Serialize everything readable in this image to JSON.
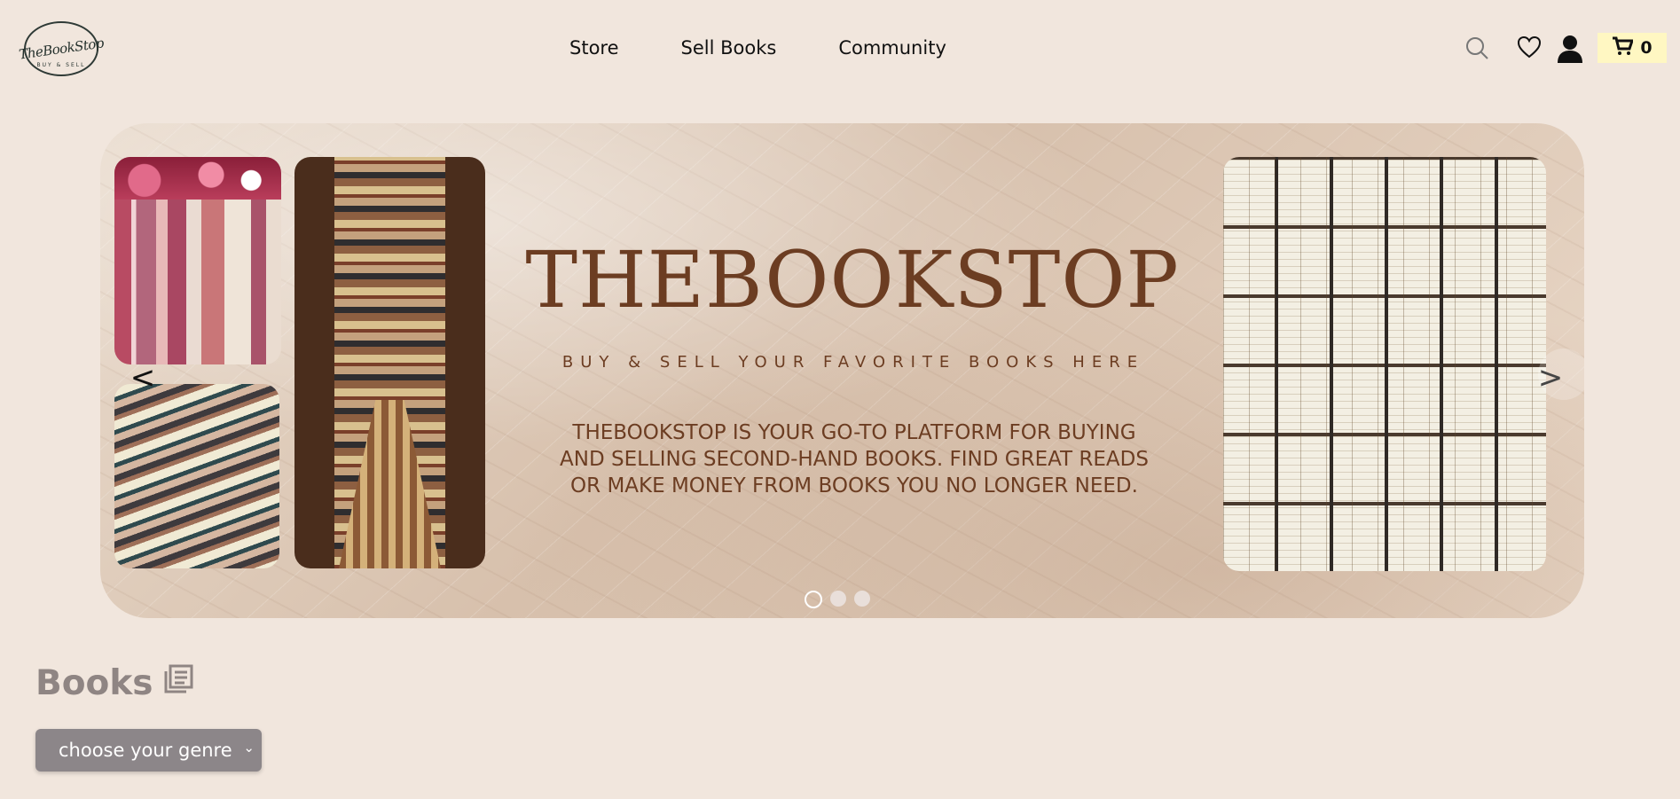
{
  "brand": {
    "logo_text": "TheBookStop",
    "logo_small": "BUY & SELL"
  },
  "nav": {
    "items": [
      "Store",
      "Sell Books",
      "Community"
    ]
  },
  "header": {
    "cart_count": "0",
    "icons": [
      "search-icon",
      "heart-icon",
      "user-icon",
      "cart-icon"
    ]
  },
  "banner": {
    "title": "THEBOOKSTOP",
    "subtitle": "BUY & SELL YOUR FAVORITE BOOKS HERE",
    "description": "THEBOOKSTOP IS YOUR GO-TO PLATFORM FOR BUYING AND SELLING SECOND-HAND BOOKS. FIND GREAT READS OR MAKE MONEY FROM BOOKS YOU NO LONGER NEED.",
    "prev_label": "<",
    "next_label": ">",
    "slides": 3,
    "active_slide": 1
  },
  "books": {
    "title": "Books",
    "genre_placeholder": "choose your genre"
  },
  "colors": {
    "page_bg": "#f1e6dd",
    "accent_brown": "#6c3d22",
    "cart_bg": "#fff7c2",
    "select_bg": "#8c8689"
  }
}
